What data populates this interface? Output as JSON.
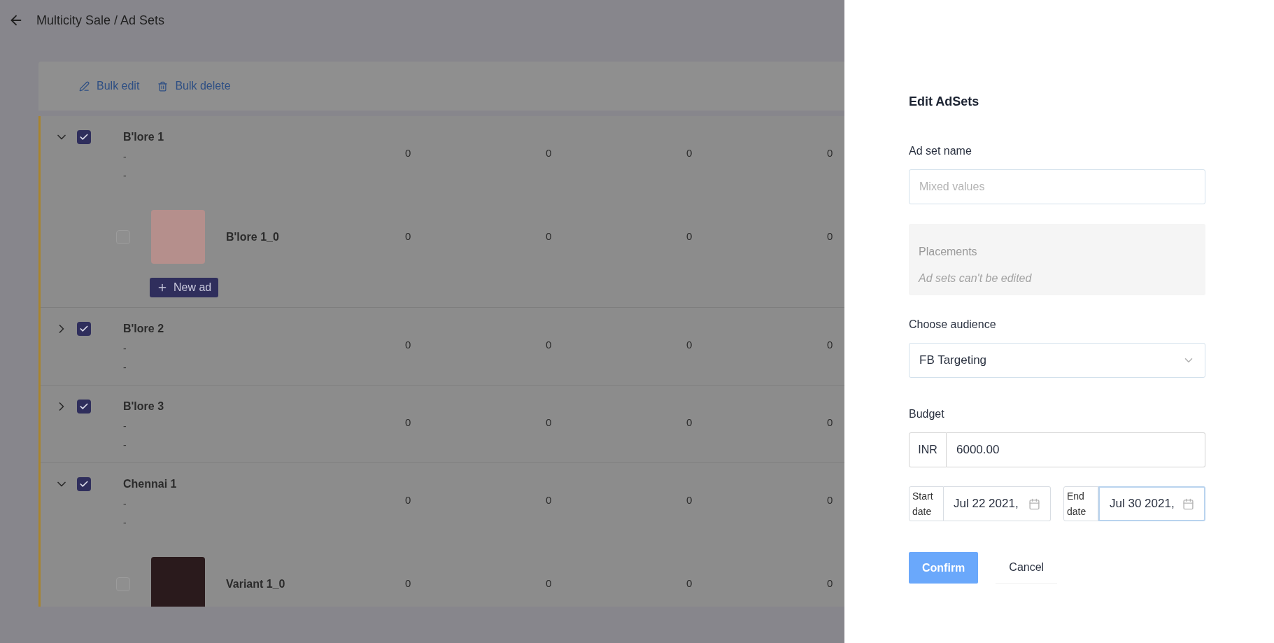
{
  "header": {
    "breadcrumb": "Multicity Sale / Ad Sets"
  },
  "toolbar": {
    "actions": [
      {
        "kind": "edit",
        "label": "Bulk edit"
      },
      {
        "kind": "delete",
        "label": "Bulk delete"
      }
    ]
  },
  "adsets": [
    {
      "name": "B'lore 1",
      "expanded": true,
      "checked": true,
      "details": [
        "-",
        "-"
      ],
      "values": [
        "0",
        "0",
        "0",
        "0"
      ],
      "ads": [
        {
          "name": "B'lore 1_0",
          "checked": false,
          "values": [
            "0",
            "0",
            "0",
            "0"
          ]
        }
      ],
      "new_ad_button": "New ad"
    },
    {
      "name": "B'lore 2",
      "expanded": false,
      "checked": true,
      "details": [
        "-",
        "-"
      ],
      "values": [
        "0",
        "0",
        "0",
        "0"
      ]
    },
    {
      "name": "B'lore 3",
      "expanded": false,
      "checked": true,
      "details": [
        "-",
        "-"
      ],
      "values": [
        "0",
        "0",
        "0",
        "0"
      ]
    },
    {
      "name": "Chennai 1",
      "expanded": true,
      "checked": true,
      "details": [
        "-",
        "-"
      ],
      "values": [
        "0",
        "0",
        "0",
        "0"
      ],
      "ads": [
        {
          "name": "Variant 1_0",
          "checked": false,
          "values": [
            "0",
            "0",
            "0",
            "0"
          ]
        }
      ]
    }
  ],
  "edit_panel": {
    "title": "Edit AdSets",
    "ad_set_name": {
      "label": "Ad set name",
      "placeholder": "Mixed values"
    },
    "placements": {
      "label": "Placements",
      "note": "Ad sets can't be edited",
      "disabled": true
    },
    "audience": {
      "label": "Choose audience",
      "value": "FB Targeting"
    },
    "budget": {
      "label": "Budget",
      "currency": "INR",
      "value": "6000.00"
    },
    "start_date": {
      "label": "Start date",
      "value": "Jul 22 2021,",
      "focused": false
    },
    "end_date": {
      "label": "End date",
      "value": "Jul 30 2021,",
      "focused": true
    },
    "buttons": [
      {
        "kind": "primary",
        "label": "Confirm"
      },
      {
        "kind": "secondary",
        "label": "Cancel"
      }
    ]
  }
}
